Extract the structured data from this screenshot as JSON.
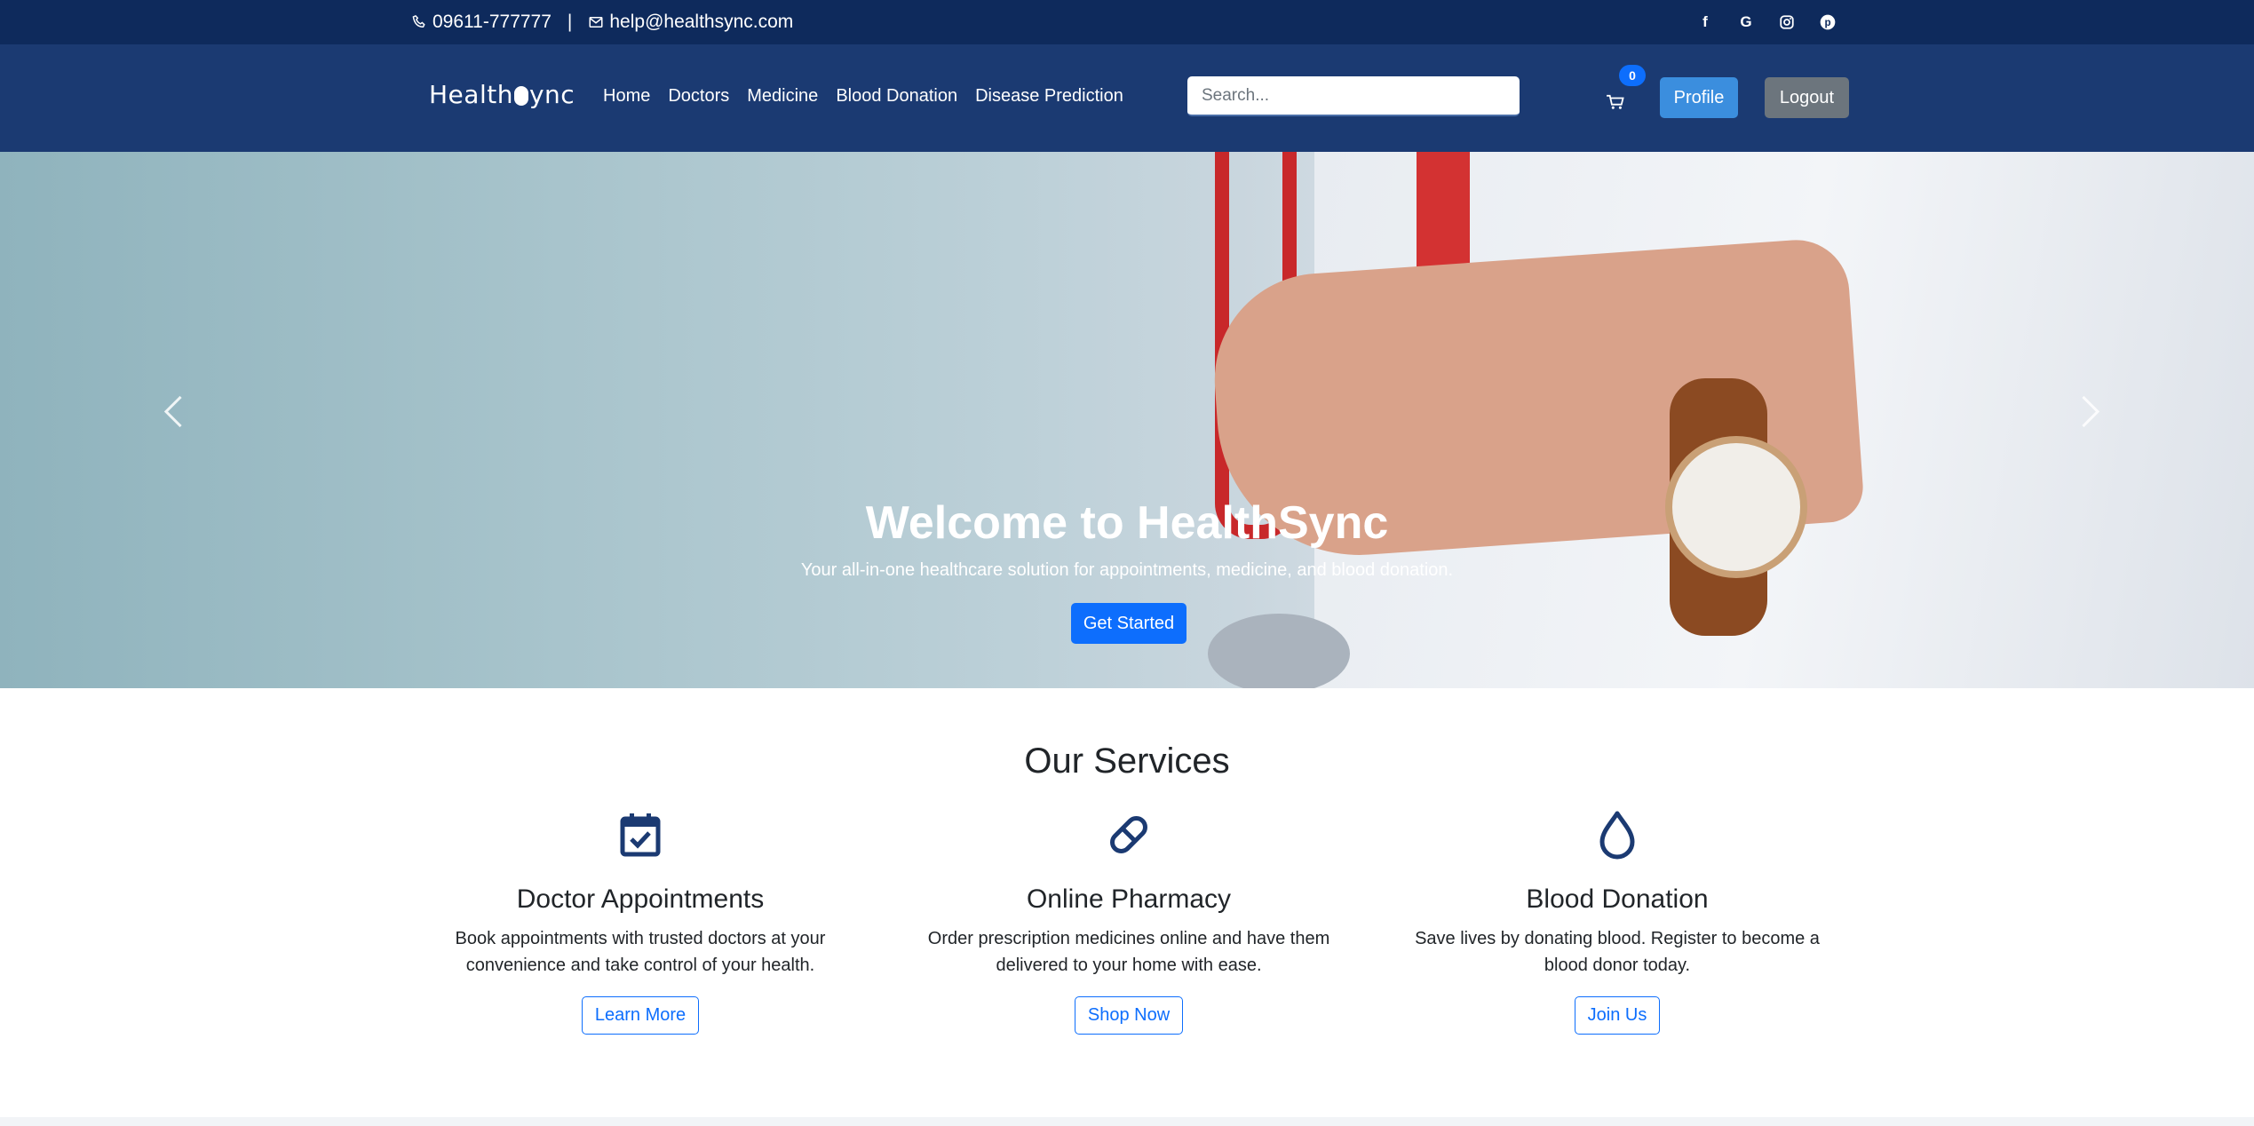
{
  "topbar": {
    "phone": "09611-777777",
    "separator": "|",
    "email": "help@healthsync.com",
    "social_icons": [
      "facebook-icon",
      "google-icon",
      "instagram-icon",
      "pinterest-icon"
    ]
  },
  "navbar": {
    "logo_left": "Health",
    "logo_right": "ync",
    "links": [
      "Home",
      "Doctors",
      "Medicine",
      "Blood Donation",
      "Disease Prediction"
    ],
    "search_placeholder": "Search...",
    "cart_count": "0",
    "profile_label": "Profile",
    "logout_label": "Logout"
  },
  "hero": {
    "title": "Welcome to HealthSync",
    "subtitle": "Your all-in-one healthcare solution for appointments, medicine, and blood donation.",
    "cta_label": "Get Started"
  },
  "services": {
    "heading": "Our Services",
    "items": [
      {
        "icon": "calendar-check-icon",
        "title": "Doctor Appointments",
        "description": "Book appointments with trusted doctors at your convenience and take control of your health.",
        "button": "Learn More"
      },
      {
        "icon": "pill-icon",
        "title": "Online Pharmacy",
        "description": "Order prescription medicines online and have them delivered to your home with ease.",
        "button": "Shop Now"
      },
      {
        "icon": "blood-drop-icon",
        "title": "Blood Donation",
        "description": "Save lives by donating blood. Register to become a blood donor today.",
        "button": "Join Us"
      }
    ]
  },
  "colors": {
    "topbar": "#0e2a5c",
    "navbar": "#1b3a72",
    "primary": "#0d6efd",
    "profile_button": "#3b8ede",
    "logout_button": "#6c757d",
    "icon": "#1b3a72"
  }
}
